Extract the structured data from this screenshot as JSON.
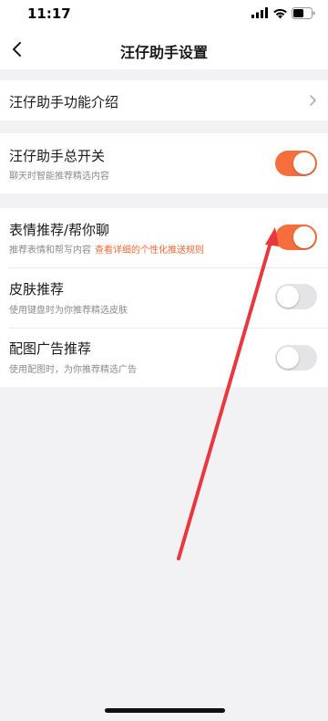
{
  "status": {
    "time": "11:17"
  },
  "nav": {
    "title": "汪仔助手设置"
  },
  "intro": {
    "label": "汪仔助手功能介绍"
  },
  "master": {
    "title": "汪仔助手总开关",
    "subtitle": "聊天时智能推荐精选内容",
    "enabled": true
  },
  "settings": [
    {
      "title": "表情推荐/帮你聊",
      "subtitle": "推荐表情和帮写内容",
      "link": "查看详细的个性化推送规则",
      "enabled": true
    },
    {
      "title": "皮肤推荐",
      "subtitle": "使用键盘时为你推荐精选皮肤",
      "enabled": false
    },
    {
      "title": "配图广告推荐",
      "subtitle": "使用配图时，为你推荐精选广告",
      "enabled": false
    }
  ],
  "colors": {
    "accent": "#f56e3c",
    "link": "#f06a35",
    "annotation_arrow": "#e8383d"
  }
}
